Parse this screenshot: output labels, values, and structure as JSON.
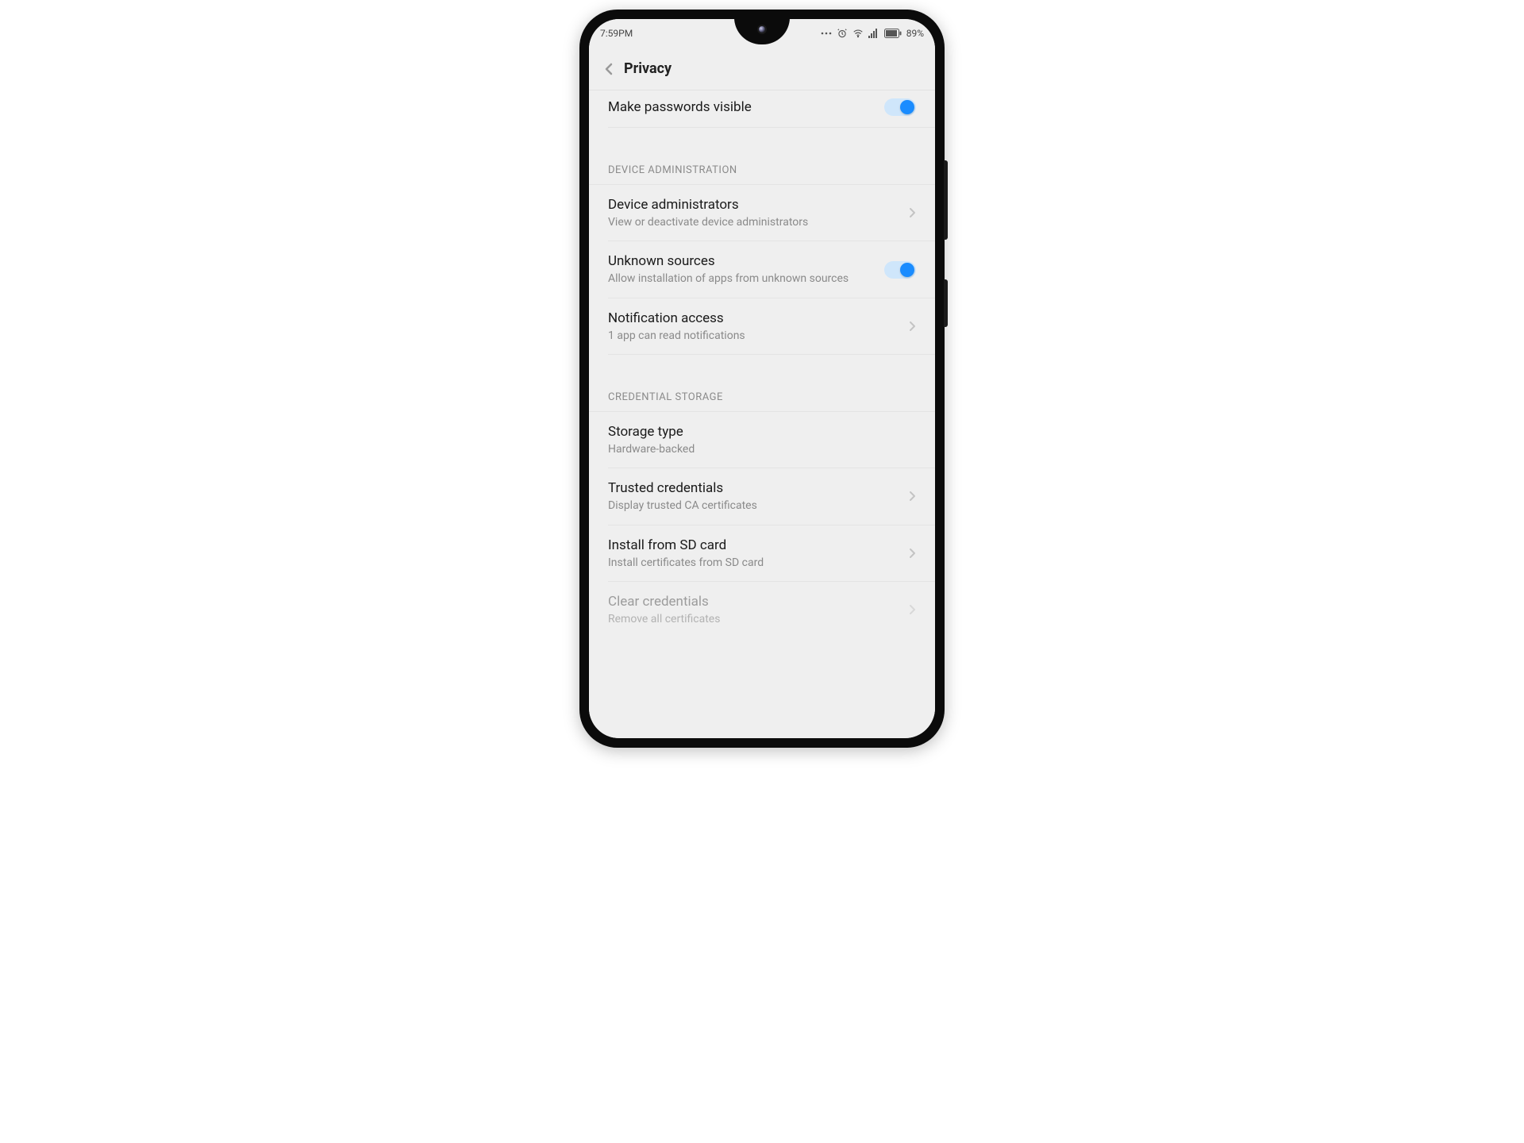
{
  "statusbar": {
    "time": "7:59PM",
    "battery_pct": "89%"
  },
  "header": {
    "title": "Privacy"
  },
  "rows": {
    "make_passwords_visible": {
      "title": "Make passwords visible"
    },
    "device_admin_header": "DEVICE ADMINISTRATION",
    "device_administrators": {
      "title": "Device administrators",
      "subtitle": "View or deactivate device administrators"
    },
    "unknown_sources": {
      "title": "Unknown sources",
      "subtitle": "Allow installation of apps from unknown sources"
    },
    "notification_access": {
      "title": "Notification access",
      "subtitle": "1 app can read notifications"
    },
    "credential_storage_header": "CREDENTIAL STORAGE",
    "storage_type": {
      "title": "Storage type",
      "subtitle": "Hardware-backed"
    },
    "trusted_credentials": {
      "title": "Trusted credentials",
      "subtitle": "Display trusted CA certificates"
    },
    "install_sd": {
      "title": "Install from SD card",
      "subtitle": "Install certificates from SD card"
    },
    "clear_credentials": {
      "title": "Clear credentials",
      "subtitle": "Remove all certificates"
    }
  },
  "toggles": {
    "make_passwords_visible": true,
    "unknown_sources": true
  }
}
